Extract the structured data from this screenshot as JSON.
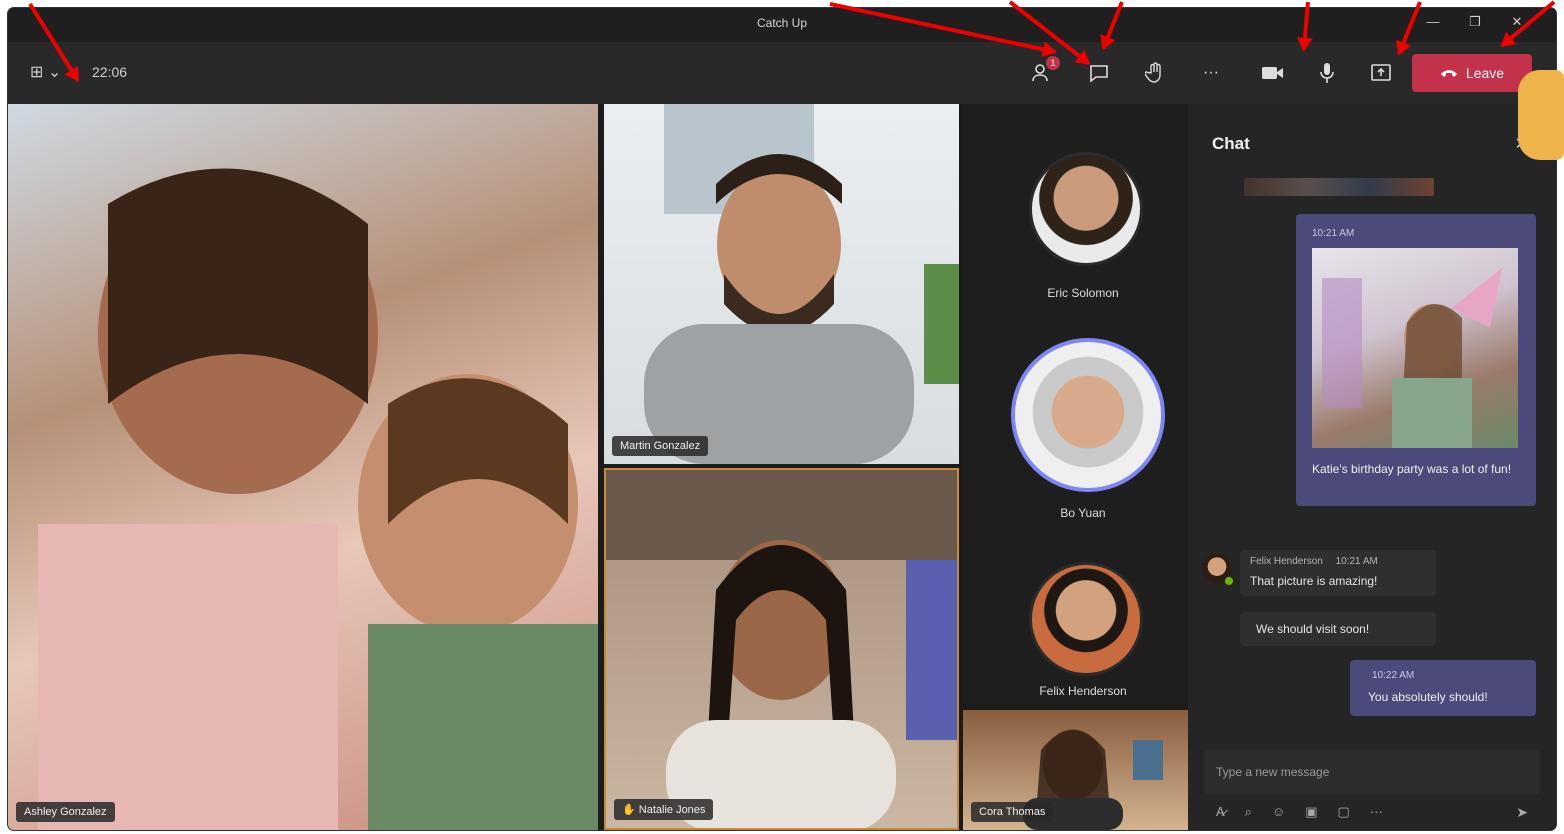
{
  "window": {
    "title": "Catch Up"
  },
  "toolbar": {
    "timer": "22:06",
    "participants_badge": "1",
    "leave_label": "Leave"
  },
  "participants": [
    {
      "name": "Ashley Gonzalez"
    },
    {
      "name": "Martin Gonzalez"
    },
    {
      "name": "Natalie Jones"
    },
    {
      "name": "Eric Solomon"
    },
    {
      "name": "Bo Yuan"
    },
    {
      "name": "Felix Henderson"
    },
    {
      "name": "Cora Thomas"
    }
  ],
  "chat": {
    "title": "Chat",
    "messages": [
      {
        "time": "10:21 AM",
        "text": "Katie's birthday party was a lot of fun!"
      },
      {
        "sender": "Felix Henderson",
        "time": "10:21 AM",
        "text": "That picture is amazing!"
      },
      {
        "text": "We should visit soon!"
      },
      {
        "time": "10:22 AM",
        "text": "You absolutely should!"
      }
    ],
    "composer_placeholder": "Type a new message"
  },
  "colors": {
    "leave": "#c4314b",
    "accent": "#4b4a7a",
    "annotation_arrow": "#e00000"
  }
}
